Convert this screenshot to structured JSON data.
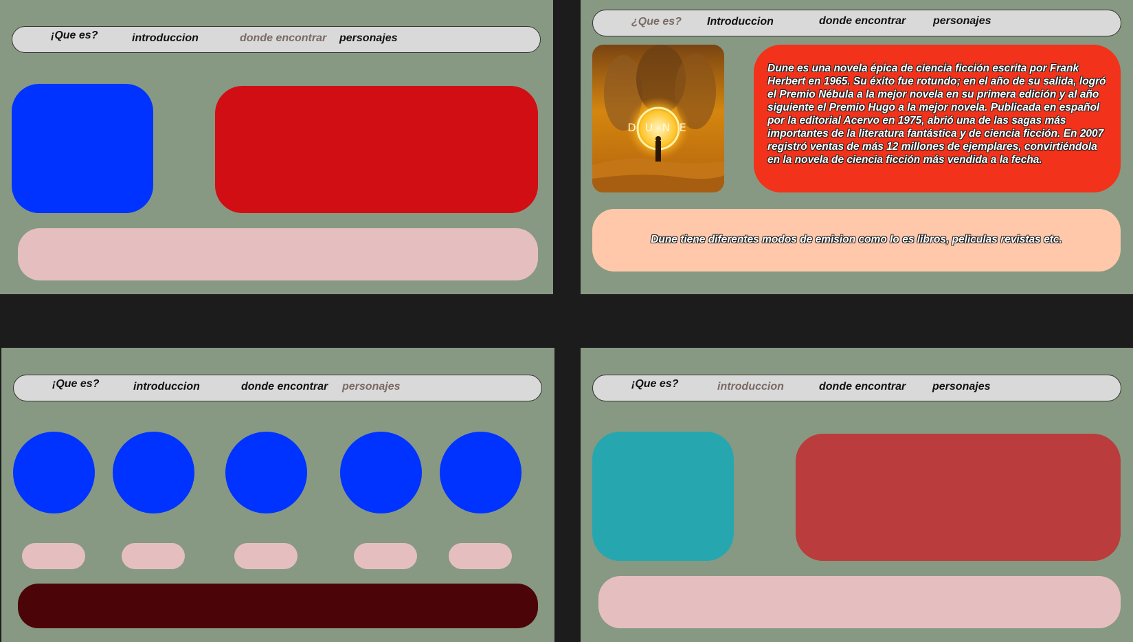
{
  "frames": {
    "top_left": {
      "nav": {
        "item1": "¡Que es?",
        "item2": "introduccion",
        "item3": "donde encontrar",
        "item4": "personajes",
        "active": "donde encontrar"
      }
    },
    "top_right": {
      "nav": {
        "item1": "¿Que es?",
        "item2": "Introduccion",
        "item3": "donde encontrar",
        "item4": "personajes",
        "active": "¿Que es?"
      },
      "poster": {
        "logo_text": "D U N E"
      },
      "description": "Dune es una novela épica de ciencia ficción escrita por Frank Herbert en 1965. Su éxito fue rotundo; en el año de su salida, logró el Premio Nébula a la mejor novela en su primera edición y al año siguiente el Premio Hugo a la mejor novela. Publicada en español por la editorial Acervo en 1975, abrió una de las sagas más importantes de la literatura fantástica y de ciencia ficción. En 2007 registró ventas de más 12 millones de ejemplares, convirtiéndola en la novela de ciencia ficción más vendida a la fecha.",
      "caption": "Dune tiene diferentes modos de emision como lo es libros, peliculas revistas etc."
    },
    "bottom_left": {
      "nav": {
        "item1": "¡Que es?",
        "item2": "introduccion",
        "item3": "donde encontrar",
        "item4": "personajes",
        "active": "personajes"
      }
    },
    "bottom_right": {
      "nav": {
        "item1": "¡Que es?",
        "item2": "introduccion",
        "item3": "donde encontrar",
        "item4": "personajes",
        "active": "introduccion"
      }
    }
  },
  "colors": {
    "frame_bg": "#879982",
    "canvas_bg": "#1c1c1c",
    "nav_bg": "#d9d9d9",
    "blue": "#0033ff",
    "red": "#d10e14",
    "pink": "#e5bfbf",
    "orange_red": "#f2321a",
    "peach": "#ffc8ab",
    "teal": "#26a7b0",
    "brick": "#bb3c3c",
    "dark_maroon": "#4b0508"
  }
}
